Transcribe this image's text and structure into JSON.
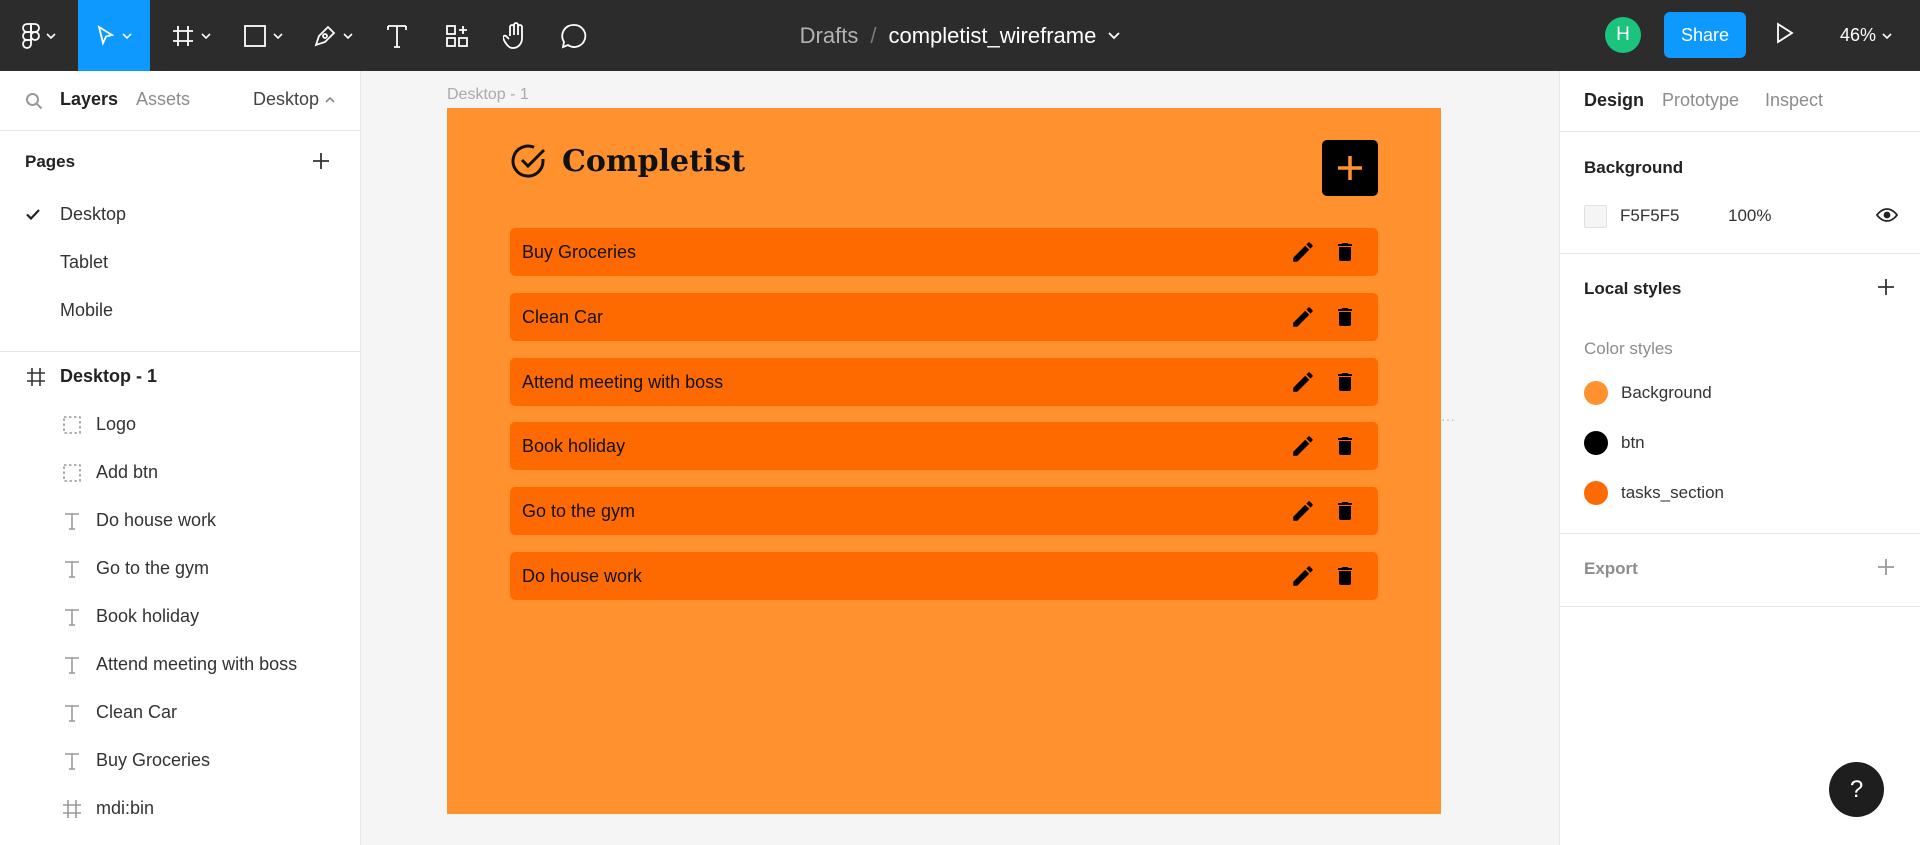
{
  "toolbar": {
    "tools": [
      {
        "name": "main-menu",
        "icon": "figma-logo-icon"
      },
      {
        "name": "move",
        "icon": "cursor-arrow-icon",
        "active": true
      },
      {
        "name": "frame",
        "icon": "frame-hash-icon"
      },
      {
        "name": "shape",
        "icon": "rectangle-icon"
      },
      {
        "name": "pen",
        "icon": "pen-icon"
      },
      {
        "name": "text",
        "icon": "text-icon"
      },
      {
        "name": "resources",
        "icon": "components-icon"
      },
      {
        "name": "hand",
        "icon": "hand-icon"
      },
      {
        "name": "comment",
        "icon": "comment-icon"
      }
    ],
    "breadcrumb_root": "Drafts",
    "breadcrumb_sep": "/",
    "file_name": "completist_wireframe",
    "avatar_initial": "H",
    "share_label": "Share",
    "zoom": "46%",
    "accent_color": "#0d99ff"
  },
  "left_panel": {
    "tabs": [
      "Layers",
      "Assets"
    ],
    "current_page": "Desktop",
    "pages_title": "Pages",
    "pages": [
      {
        "label": "Desktop",
        "selected": true
      },
      {
        "label": "Tablet",
        "selected": false
      },
      {
        "label": "Mobile",
        "selected": false
      }
    ],
    "layers": [
      {
        "label": "Desktop - 1",
        "type": "frame",
        "icon": "frame-hash-icon"
      },
      {
        "label": "Logo",
        "type": "group",
        "icon": "dashed-group-icon"
      },
      {
        "label": "Add btn",
        "type": "group",
        "icon": "dashed-group-icon"
      },
      {
        "label": "Do house work",
        "type": "text",
        "icon": "text-icon"
      },
      {
        "label": "Go to the gym",
        "type": "text",
        "icon": "text-icon"
      },
      {
        "label": "Book holiday",
        "type": "text",
        "icon": "text-icon"
      },
      {
        "label": "Attend meeting with boss",
        "type": "text",
        "icon": "text-icon"
      },
      {
        "label": "Clean Car",
        "type": "text",
        "icon": "text-icon"
      },
      {
        "label": "Buy Groceries",
        "type": "text",
        "icon": "text-icon"
      },
      {
        "label": "mdi:bin",
        "type": "frame",
        "icon": "frame-hash-icon"
      }
    ]
  },
  "canvas": {
    "frame_label": "Desktop - 1",
    "frame_color": "#ff922e",
    "app_title": "Completist",
    "task_color": "#ff6a00",
    "tasks": [
      "Buy Groceries",
      "Clean Car",
      "Attend meeting with boss",
      "Book holiday",
      "Go to the gym",
      "Do house work"
    ]
  },
  "right_panel": {
    "tabs": [
      "Design",
      "Prototype",
      "Inspect"
    ],
    "background_title": "Background",
    "background_hex": "F5F5F5",
    "background_opacity": "100%",
    "local_styles_title": "Local styles",
    "color_styles_title": "Color styles",
    "color_styles": [
      {
        "name": "Background",
        "color": "#ff922e"
      },
      {
        "name": "btn",
        "color": "#000000"
      },
      {
        "name": "tasks_section",
        "color": "#ff6a00"
      }
    ],
    "export_title": "Export"
  },
  "help_label": "?"
}
